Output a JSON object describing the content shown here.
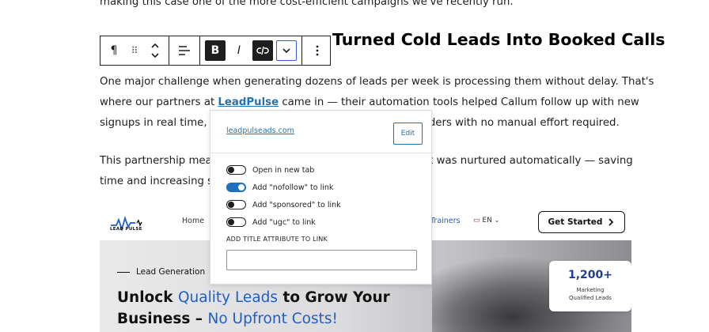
{
  "article": {
    "line_top": "making this case one of the more cost-efficient campaigns we've recently run.",
    "heading_visible": "Turned Cold Leads Into Booked Calls",
    "p1_line1": "One major challenge when generating dozens of leads per week is processing them without delay. That's",
    "p1_line2_pre": "where our partners at ",
    "p1_link": "LeadPulse",
    "p1_line2_post": " came in — their automation tools helped Callum follow up with new",
    "p1_line3_pre": "signups in real time, m",
    "p1_line3_post": "inders with no manual effort required.",
    "p2_line1_pre": "This partnership mean",
    "p2_line1_post": "t was nurtured automatically — saving",
    "p2_line2": "time and increasing sh"
  },
  "toolbar": {
    "paragraph_icon": "¶",
    "drag_icon": "⠿",
    "bold_label": "B",
    "italic_label": "I"
  },
  "link_popover": {
    "url": "leadpulseads.com",
    "edit_label": "Edit",
    "options": [
      {
        "label": "Open in new tab",
        "on": false
      },
      {
        "label": "Add \"nofollow\" to link",
        "on": true
      },
      {
        "label": "Add \"sponsored\" to link",
        "on": false
      },
      {
        "label": "Add \"ugc\" to link",
        "on": false
      }
    ],
    "title_attr_label": "ADD TITLE ATTRIBUTE TO LINK",
    "title_attr_value": ""
  },
  "site_preview": {
    "logo_text": "LEAD PULSE",
    "nav_home": "Home",
    "nav_trainers": "Trainers",
    "nav_lang": "EN",
    "cta": "Get Started",
    "eyebrow": "Lead Generation",
    "headline1_a": "Unlock ",
    "headline1_b": "Quality Leads",
    "headline1_c": " to Grow Your",
    "headline2_a": "Business – ",
    "headline2_b": "No Upfront Costs!",
    "stat_value": "1,200+",
    "stat_label1": "Marketing",
    "stat_label2": "Qualified Leads"
  },
  "colors": {
    "link": "#2271b1",
    "toggle_on": "#1e6fbf",
    "brand_blue": "#1f5fc4"
  }
}
